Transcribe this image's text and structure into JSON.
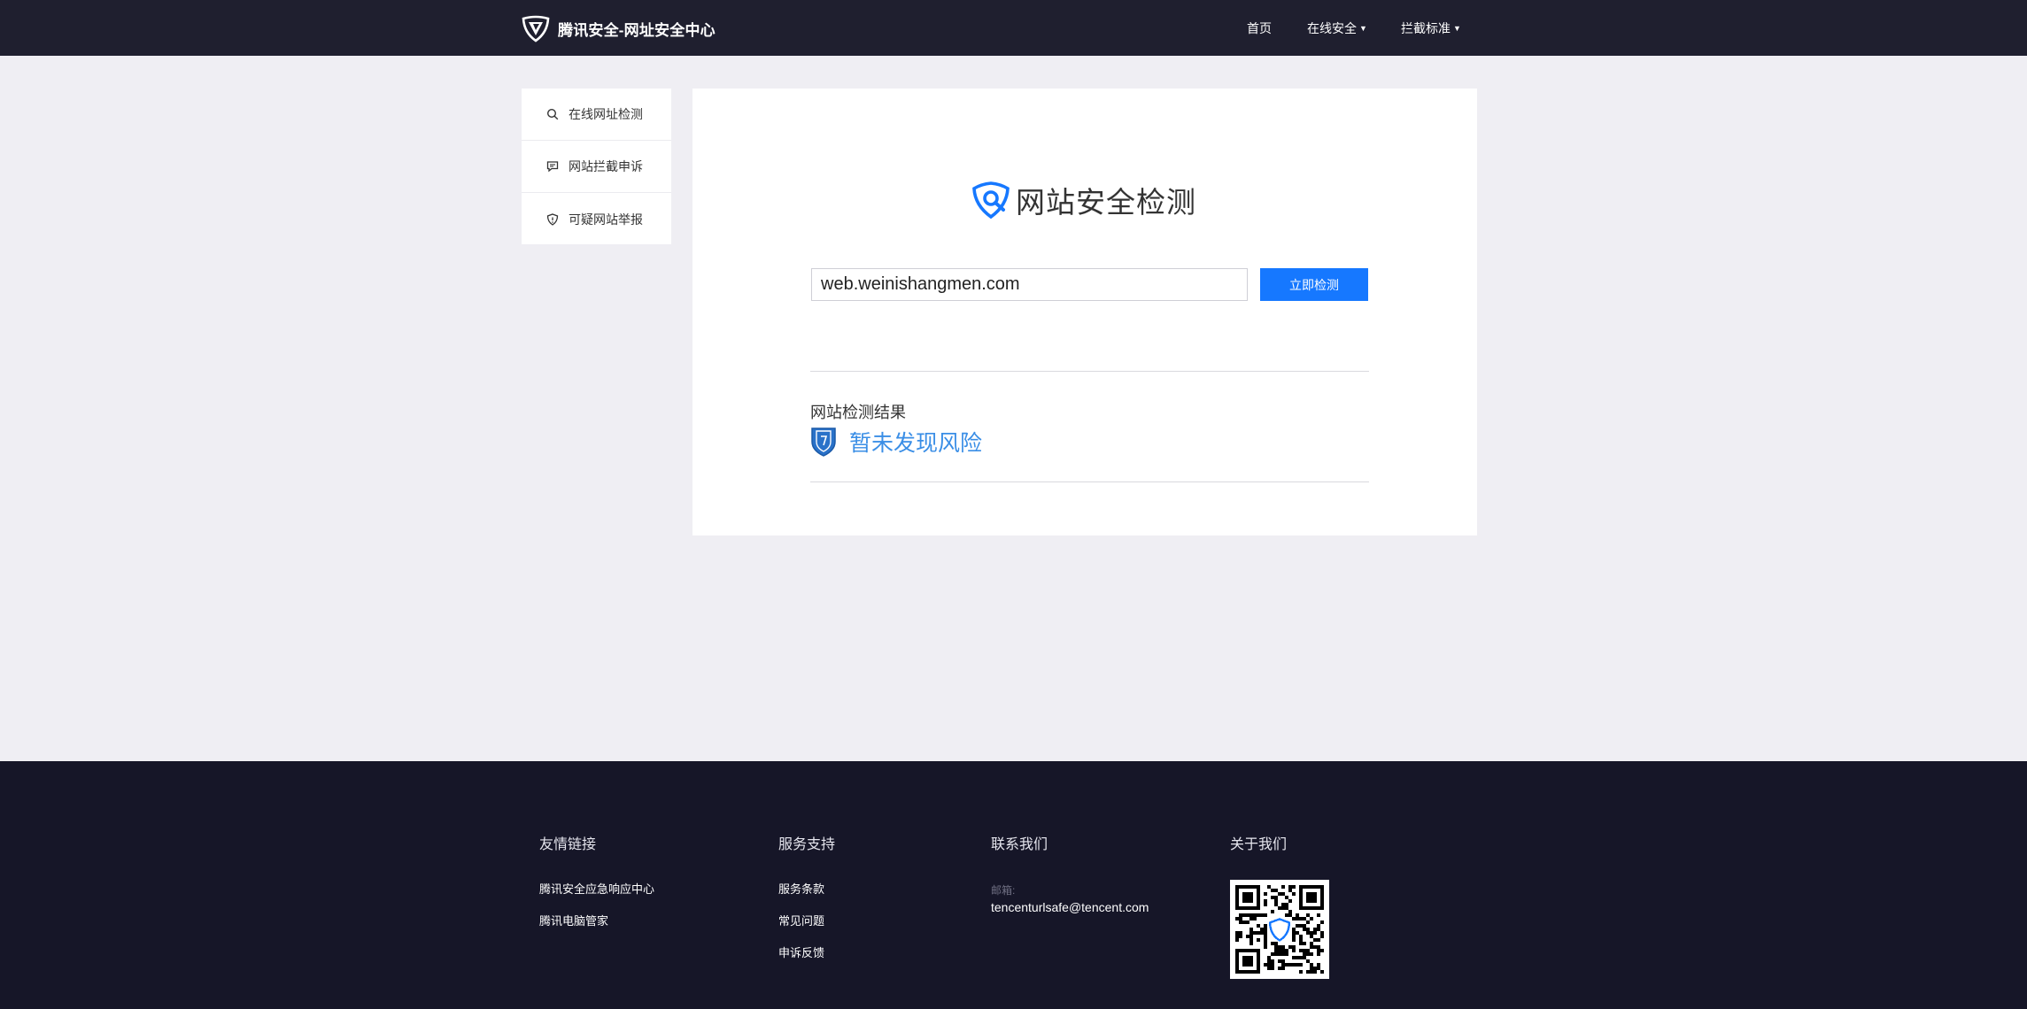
{
  "header": {
    "brand": "腾讯安全-网址安全中心",
    "nav": {
      "home": "首页",
      "online_security": "在线安全",
      "block_standard": "拦截标准"
    }
  },
  "sidebar": {
    "items": [
      {
        "label": "在线网址检测",
        "icon": "search-icon"
      },
      {
        "label": "网站拦截申诉",
        "icon": "chat-icon"
      },
      {
        "label": "可疑网站举报",
        "icon": "shield-icon"
      }
    ]
  },
  "main": {
    "title": "网站安全检测",
    "url_value": "web.weinishangmen.com",
    "check_button": "立即检测",
    "result_label": "网站检测结果",
    "result_text": "暂未发现风险"
  },
  "footer": {
    "friend_links": {
      "title": "友情链接",
      "links": [
        "腾讯安全应急响应中心",
        "腾讯电脑管家"
      ]
    },
    "support": {
      "title": "服务支持",
      "links": [
        "服务条款",
        "常见问题",
        "申诉反馈"
      ]
    },
    "contact": {
      "title": "联系我们",
      "email_label": "邮箱:",
      "email": "tencenturlsafe@tencent.com"
    },
    "about": {
      "title": "关于我们"
    }
  },
  "colors": {
    "header_bg": "#1f1f2f",
    "footer_bg": "#161628",
    "page_bg": "#efeef3",
    "primary": "#1678ff",
    "result": "#3a8ee6"
  }
}
